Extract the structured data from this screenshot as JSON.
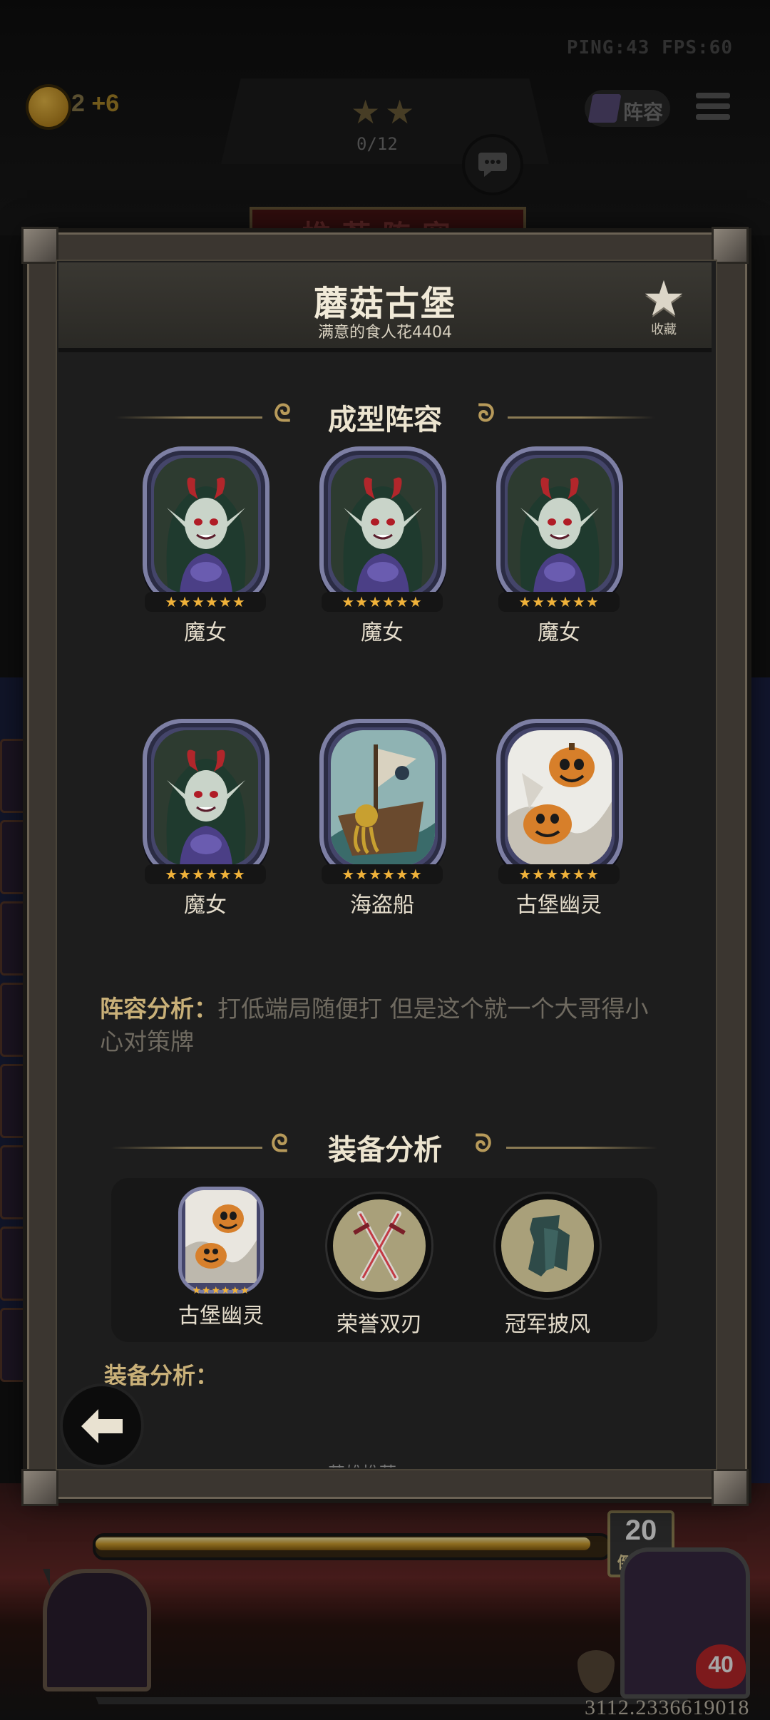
{
  "hud": {
    "ping_fps": "PING:43   FPS:60",
    "coins": "2",
    "coins_bonus": "+6",
    "stage_progress": "0/12",
    "lineup_btn": "阵容",
    "banner": "推荐阵容",
    "timer_value": "20",
    "timer_label": "倒计时",
    "timer_progress": 0.98,
    "player_level": "40",
    "coordinates": "3112.2336619018"
  },
  "modal": {
    "title": "蘑菇古堡",
    "subtitle": "满意的食人花4404",
    "favorite_label": "收藏",
    "lineup_section_title": "成型阵容",
    "heroes": [
      {
        "name": "魔女",
        "stars": "★★★★★★",
        "portrait": "witch"
      },
      {
        "name": "魔女",
        "stars": "★★★★★★",
        "portrait": "witch"
      },
      {
        "name": "魔女",
        "stars": "★★★★★★",
        "portrait": "witch"
      },
      {
        "name": "魔女",
        "stars": "★★★★★★",
        "portrait": "witch"
      },
      {
        "name": "海盗船",
        "stars": "★★★★★★",
        "portrait": "pirate-ship"
      },
      {
        "name": "古堡幽灵",
        "stars": "★★★★★★",
        "portrait": "pumpkin-ghost"
      }
    ],
    "analysis_label": "阵容分析：",
    "analysis_text": "打低端局随便打 但是这个就一个大哥得小心对策牌",
    "equipment_section_title": "装备分析",
    "equipment": [
      {
        "name": "古堡幽灵",
        "stars": "★★★★★★",
        "type": "hero"
      },
      {
        "name": "荣誉双刃",
        "type": "item",
        "icon": "twin-blades-icon"
      },
      {
        "name": "冠军披风",
        "type": "item",
        "icon": "cloak-icon"
      }
    ],
    "equipment_analysis_label": "装备分析：",
    "cutoff_text": "英雄推荐"
  },
  "colors": {
    "accent_gold": "#c9b078",
    "star_gold": "#f0b23a",
    "frame_purple": "#7d7fa4",
    "panel_bg": "#1d1d1d"
  }
}
